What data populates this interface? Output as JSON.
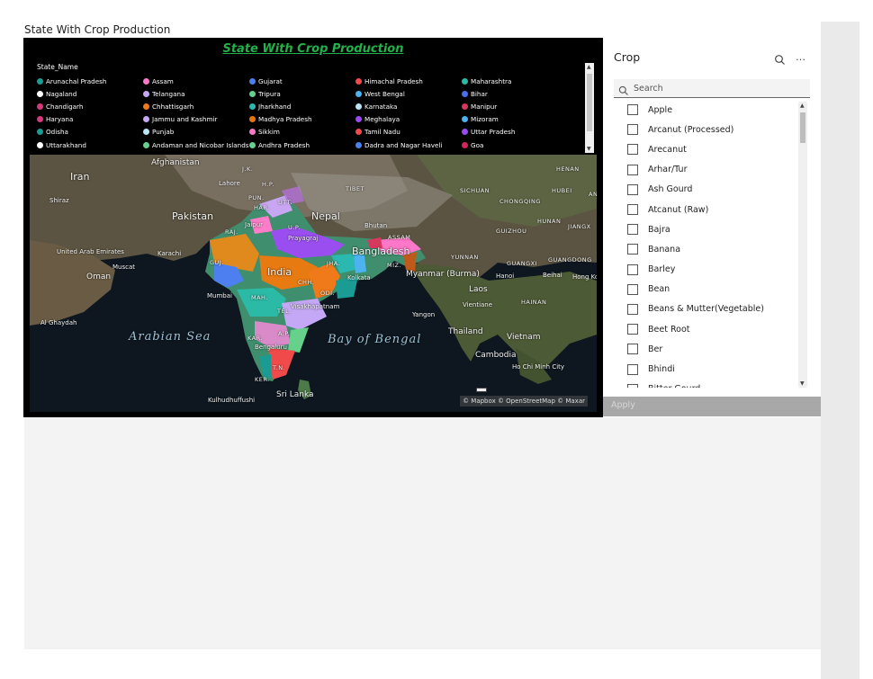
{
  "page": {
    "title": "State With Crop Production"
  },
  "map": {
    "title": "State With Crop Production",
    "legend": {
      "title": "State_Name",
      "items": [
        {
          "label": "Arunachal Pradesh",
          "color": "#1a9c95"
        },
        {
          "label": "Assam",
          "color": "#ff77c8"
        },
        {
          "label": "Gujarat",
          "color": "#4a7ff0"
        },
        {
          "label": "Himachal Pradesh",
          "color": "#f04a4a"
        },
        {
          "label": "Maharashtra",
          "color": "#2bbaa6"
        },
        {
          "label": "Nagaland",
          "color": "#ffffff"
        },
        {
          "label": "Telangana",
          "color": "#c4a7f5"
        },
        {
          "label": "Tripura",
          "color": "#65d18a"
        },
        {
          "label": "West Bengal",
          "color": "#4db2f0"
        },
        {
          "label": "Bihar",
          "color": "#4a6ff0"
        },
        {
          "label": "Chandigarh",
          "color": "#d63a7a"
        },
        {
          "label": "Chhattisgarh",
          "color": "#f07a1a"
        },
        {
          "label": "Jharkhand",
          "color": "#2bb8b0"
        },
        {
          "label": "Karnataka",
          "color": "#b8e4f5"
        },
        {
          "label": "Manipur",
          "color": "#d9385e"
        },
        {
          "label": "Haryana",
          "color": "#d63a7a"
        },
        {
          "label": "Jammu and Kashmir",
          "color": "#c4a7f5"
        },
        {
          "label": "Madhya Pradesh",
          "color": "#e8750a"
        },
        {
          "label": "Meghalaya",
          "color": "#9b4af0"
        },
        {
          "label": "Mizoram",
          "color": "#4db2f0"
        },
        {
          "label": "Odisha",
          "color": "#1a9c95"
        },
        {
          "label": "Punjab",
          "color": "#b8e4f5"
        },
        {
          "label": "Sikkim",
          "color": "#ff77c8"
        },
        {
          "label": "Tamil Nadu",
          "color": "#f04a4a"
        },
        {
          "label": "Uttar Pradesh",
          "color": "#9b4af0"
        },
        {
          "label": "Uttarakhand",
          "color": "#ffffff"
        },
        {
          "label": "Andaman and Nicobar Islands",
          "color": "#65d18a"
        },
        {
          "label": "Andhra Pradesh",
          "color": "#65d18a"
        },
        {
          "label": "Dadra and Nagar Haveli",
          "color": "#4a7ff0"
        },
        {
          "label": "Goa",
          "color": "#d6245e"
        }
      ]
    },
    "places": [
      {
        "label": "Iran",
        "size": "lg"
      },
      {
        "label": "Afghanistan",
        "size": "md"
      },
      {
        "label": "Pakistan",
        "size": "lg"
      },
      {
        "label": "Nepal",
        "size": "lg"
      },
      {
        "label": "Bhutan",
        "size": "sm"
      },
      {
        "label": "Bangladesh",
        "size": "lg"
      },
      {
        "label": "India",
        "size": "lg"
      },
      {
        "label": "Myanmar (Burma)",
        "size": "md"
      },
      {
        "label": "Laos",
        "size": "md"
      },
      {
        "label": "Thailand",
        "size": "md"
      },
      {
        "label": "Vietnam",
        "size": "md"
      },
      {
        "label": "Cambodia",
        "size": "md"
      },
      {
        "label": "Sri Lanka",
        "size": "md"
      },
      {
        "label": "Oman",
        "size": "md"
      },
      {
        "label": "Karachi",
        "size": "sm"
      },
      {
        "label": "Muscat",
        "size": "sm"
      },
      {
        "label": "Mumbai",
        "size": "sm"
      },
      {
        "label": "Kolkata",
        "size": "sm"
      },
      {
        "label": "Visakhapatnam",
        "size": "sm"
      },
      {
        "label": "Bengaluru",
        "size": "sm"
      },
      {
        "label": "Yangon",
        "size": "sm"
      },
      {
        "label": "Hanoi",
        "size": "sm"
      },
      {
        "label": "Vientiane",
        "size": "sm"
      },
      {
        "label": "Ho Chi Minh City",
        "size": "sm"
      },
      {
        "label": "Kulhudhuffushi",
        "size": "sm"
      },
      {
        "label": "Prayagraj",
        "size": "sm"
      },
      {
        "label": "Jaipur",
        "size": "sm"
      },
      {
        "label": "Lahore",
        "size": "sm"
      },
      {
        "label": "Shiraz",
        "size": "sm"
      },
      {
        "label": "Beihai",
        "size": "sm"
      },
      {
        "label": "Hong Ko",
        "size": "sm"
      },
      {
        "label": "United Arab Emirates",
        "size": "sm"
      },
      {
        "label": "Al Ghaydah",
        "size": "sm"
      },
      {
        "label": "J.K.",
        "size": "caps"
      },
      {
        "label": "H.P.",
        "size": "caps"
      },
      {
        "label": "PUN.",
        "size": "caps"
      },
      {
        "label": "HAR.",
        "size": "caps"
      },
      {
        "label": "UTT.",
        "size": "caps"
      },
      {
        "label": "RAJ.",
        "size": "caps"
      },
      {
        "label": "U.P.",
        "size": "caps"
      },
      {
        "label": "GUJ.",
        "size": "caps"
      },
      {
        "label": "JHA.",
        "size": "caps"
      },
      {
        "label": "CHH.",
        "size": "caps"
      },
      {
        "label": "MAH.",
        "size": "caps"
      },
      {
        "label": "ODI.",
        "size": "caps"
      },
      {
        "label": "TEL.",
        "size": "caps"
      },
      {
        "label": "KAR.",
        "size": "caps"
      },
      {
        "label": "A.P.",
        "size": "caps"
      },
      {
        "label": "T.N.",
        "size": "caps"
      },
      {
        "label": "KER.",
        "size": "caps"
      },
      {
        "label": "ASSAM",
        "size": "caps"
      },
      {
        "label": "MIZ.",
        "size": "caps"
      },
      {
        "label": "TIBET",
        "size": "caps"
      },
      {
        "label": "SICHUAN",
        "size": "caps"
      },
      {
        "label": "CHONGQING",
        "size": "caps"
      },
      {
        "label": "HUBEI",
        "size": "caps"
      },
      {
        "label": "HENAN",
        "size": "caps"
      },
      {
        "label": "HUNAN",
        "size": "caps"
      },
      {
        "label": "JIANGX",
        "size": "caps"
      },
      {
        "label": "GUIZHOU",
        "size": "caps"
      },
      {
        "label": "YUNNAN",
        "size": "caps"
      },
      {
        "label": "GUANGXI",
        "size": "caps"
      },
      {
        "label": "GUANGDONG",
        "size": "caps"
      },
      {
        "label": "HAINAN",
        "size": "caps"
      },
      {
        "label": "AN",
        "size": "caps"
      }
    ],
    "seas": [
      "Arabian Sea",
      "Bay of Bengal"
    ],
    "attribution": "© Mapbox © OpenStreetMap © Maxar"
  },
  "slicer": {
    "title": "Crop",
    "search_placeholder": "Search",
    "items": [
      "Apple",
      "Arcanut (Processed)",
      "Arecanut",
      "Arhar/Tur",
      "Ash Gourd",
      "Atcanut (Raw)",
      "Bajra",
      "Banana",
      "Barley",
      "Bean",
      "Beans & Mutter(Vegetable)",
      "Beet Root",
      "Ber",
      "Bhindi",
      "Bitter Gourd"
    ],
    "apply_label": "Apply"
  }
}
